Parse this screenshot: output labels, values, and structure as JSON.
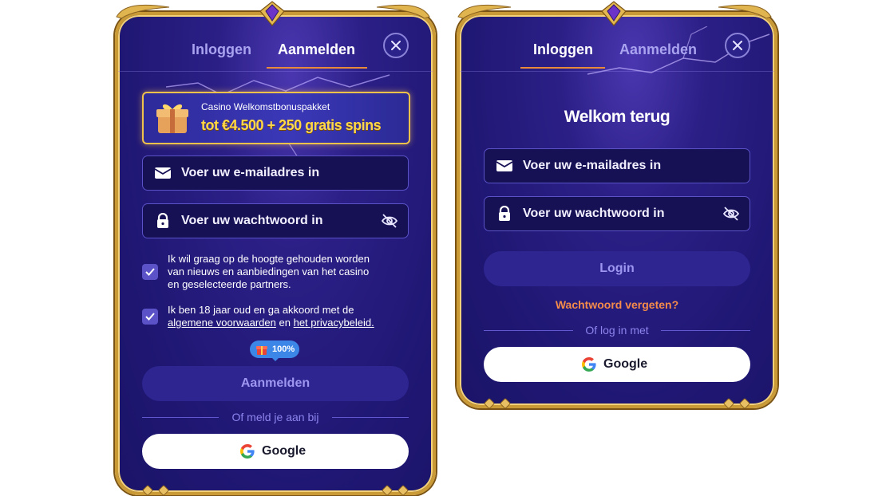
{
  "colors": {
    "accent": "#e98a3a",
    "frame_gold": "#c99a35",
    "panel": "#1f1773",
    "link_orange": "#f48b4a",
    "google_blue": "#4285F4"
  },
  "signup_modal": {
    "tabs": [
      {
        "label": "Inloggen",
        "active": false
      },
      {
        "label": "Aanmelden",
        "active": true
      }
    ],
    "close_icon": "close-icon",
    "banner": {
      "title": "Casino Welkomstbonuspakket",
      "offer": "tot €4.500 + 250 gratis spins",
      "icon": "gift-icon"
    },
    "email_placeholder": "Voer uw e-mailadres in",
    "password_placeholder": "Voer uw wachtwoord in",
    "newsletter": {
      "checked": true,
      "line1": "Ik wil graag op de hoogte gehouden worden",
      "line2": "van nieuws en aanbiedingen van het casino",
      "line3": "en geselecteerde partners."
    },
    "terms": {
      "checked": true,
      "line1": "Ik ben 18 jaar oud en ga akkoord met de",
      "link1": "algemene voorwaarden",
      "connector": "en",
      "link2": "het privacybeleid."
    },
    "bonus_badge": "100%",
    "submit_label": "Aanmelden",
    "or_text": "Of meld je aan bij",
    "google_label": "Google"
  },
  "login_modal": {
    "tabs": [
      {
        "label": "Inloggen",
        "active": true
      },
      {
        "label": "Aanmelden",
        "active": false
      }
    ],
    "close_icon": "close-icon",
    "heading": "Welkom terug",
    "email_placeholder": "Voer uw e-mailadres in",
    "password_placeholder": "Voer uw wachtwoord in",
    "submit_label": "Login",
    "forgot_label": "Wachtwoord vergeten?",
    "or_text": "Of log in met",
    "google_label": "Google"
  }
}
